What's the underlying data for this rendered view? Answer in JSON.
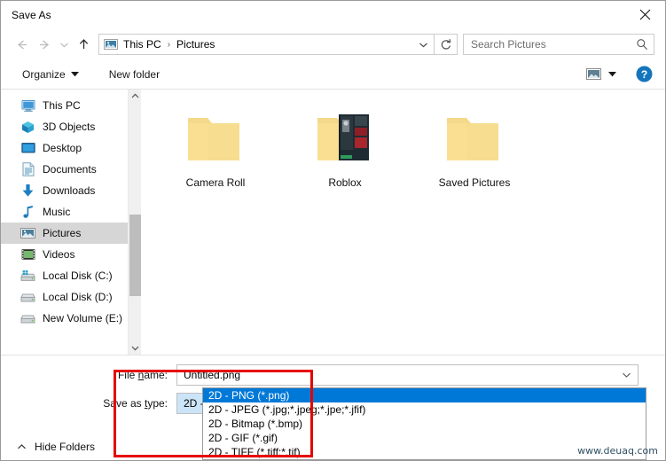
{
  "window": {
    "title": "Save As",
    "close_icon": "close-icon"
  },
  "navigation": {
    "back_icon": "arrow-left-icon",
    "forward_icon": "arrow-right-icon",
    "recent_icon": "chevron-down-icon",
    "up_icon": "arrow-up-icon",
    "location_icon": "pictures-folder-icon",
    "breadcrumbs": [
      "This PC",
      "Pictures"
    ],
    "separator": "›",
    "dropdown_icon": "chevron-down-icon",
    "refresh_icon": "refresh-icon"
  },
  "search": {
    "placeholder": "Search Pictures",
    "icon": "search-icon"
  },
  "command_bar": {
    "organize_label": "Organize",
    "organize_caret": "caret-down-icon",
    "new_folder_label": "New folder",
    "view_icon": "view-layout-icon",
    "view_caret": "caret-down-icon",
    "help_icon": "help-icon"
  },
  "sidebar": {
    "scroll_up_icon": "chevron-up-icon",
    "scroll_down_icon": "chevron-down-icon",
    "items": [
      {
        "label": "This PC",
        "icon": "monitor-icon",
        "selected": false
      },
      {
        "label": "3D Objects",
        "icon": "cube-icon",
        "selected": false
      },
      {
        "label": "Desktop",
        "icon": "desktop-icon",
        "selected": false
      },
      {
        "label": "Documents",
        "icon": "document-icon",
        "selected": false
      },
      {
        "label": "Downloads",
        "icon": "download-icon",
        "selected": false
      },
      {
        "label": "Music",
        "icon": "music-note-icon",
        "selected": false
      },
      {
        "label": "Pictures",
        "icon": "pictures-icon",
        "selected": true
      },
      {
        "label": "Videos",
        "icon": "video-icon",
        "selected": false
      },
      {
        "label": "Local Disk (C:)",
        "icon": "disk-system-icon",
        "selected": false
      },
      {
        "label": "Local Disk (D:)",
        "icon": "disk-icon",
        "selected": false
      },
      {
        "label": "New Volume (E:)",
        "icon": "disk-icon",
        "selected": false
      }
    ]
  },
  "files": [
    {
      "name": "Camera Roll",
      "icon": "folder-icon"
    },
    {
      "name": "Roblox",
      "icon": "folder-with-preview-icon"
    },
    {
      "name": "Saved Pictures",
      "icon": "folder-icon"
    }
  ],
  "form": {
    "file_name_label_pre": "File ",
    "file_name_label_accel": "n",
    "file_name_label_post": "ame:",
    "file_name_value": "Untitled.png",
    "save_type_label_pre": "Save as ",
    "save_type_label_accel": "t",
    "save_type_label_post": "ype:",
    "save_type_value": "2D - PNG (*.png)",
    "caret_icon": "chevron-down-icon"
  },
  "dropdown_options": [
    {
      "label": "2D - PNG (*.png)",
      "selected": true
    },
    {
      "label": "2D - JPEG (*.jpg;*.jpeg;*.jpe;*.jfif)",
      "selected": false
    },
    {
      "label": "2D - Bitmap (*.bmp)",
      "selected": false
    },
    {
      "label": "2D - GIF (*.gif)",
      "selected": false
    },
    {
      "label": "2D - TIFF (*.tiff;*.tif)",
      "selected": false
    }
  ],
  "footer": {
    "hide_folders_label": "Hide Folders",
    "hide_folders_icon": "chevron-up-icon"
  },
  "watermark": {
    "text": "www.deuaq.com"
  },
  "colors": {
    "accent": "#0078d7",
    "combo_fill": "#cce4f7",
    "annotation": "#e60000",
    "selected_nav": "#d6d6d6"
  }
}
